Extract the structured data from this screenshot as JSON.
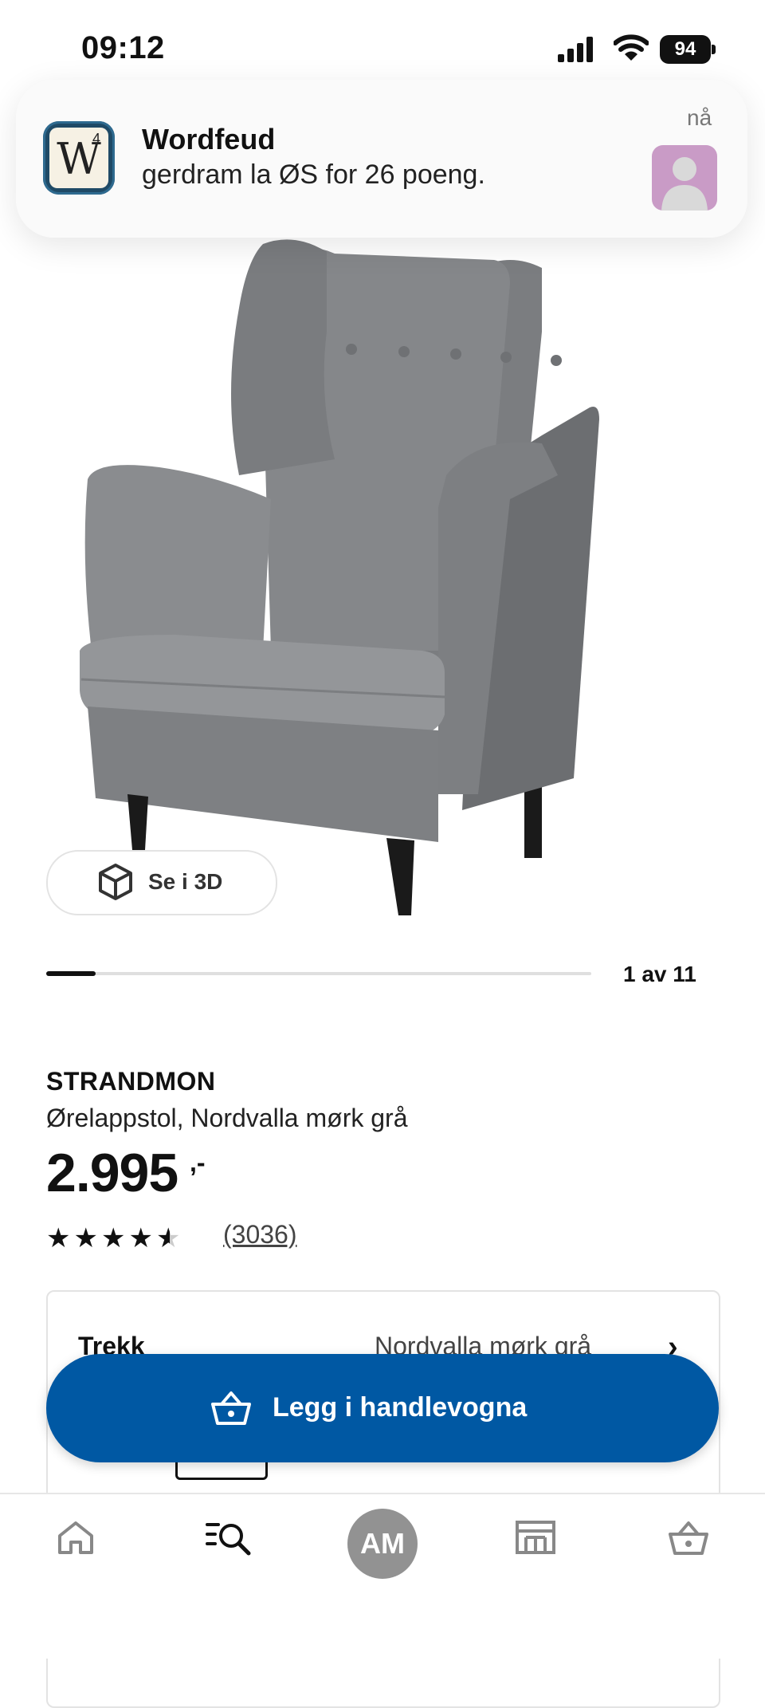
{
  "status_bar": {
    "time": "09:12",
    "battery": "94"
  },
  "notification": {
    "app_name": "Wordfeud",
    "message": "gerdram la ØS for 26 poeng.",
    "time": "nå",
    "icon_letter": "W",
    "icon_superscript": "4"
  },
  "product": {
    "view_3d_label": "Se i 3D",
    "carousel_counter": "1 av 11",
    "carousel_progress": 0.09,
    "name": "STRANDMON",
    "description": "Ørelappstol, Nordvalla mørk grå",
    "price": "2.995",
    "price_suffix": ",-",
    "rating_stars": "★★★★★",
    "rating_value": 4.5,
    "review_count": "(3036)"
  },
  "options": {
    "label": "Trekk",
    "value": "Nordvalla mørk grå"
  },
  "cta": {
    "label": "Legg i handlevogna",
    "color": "#0058a3"
  },
  "bottom_nav": {
    "items": [
      {
        "icon": "home-icon"
      },
      {
        "icon": "search-list-icon"
      },
      {
        "icon": "avatar",
        "label": "AM"
      },
      {
        "icon": "store-icon"
      },
      {
        "icon": "cart-icon"
      }
    ]
  }
}
